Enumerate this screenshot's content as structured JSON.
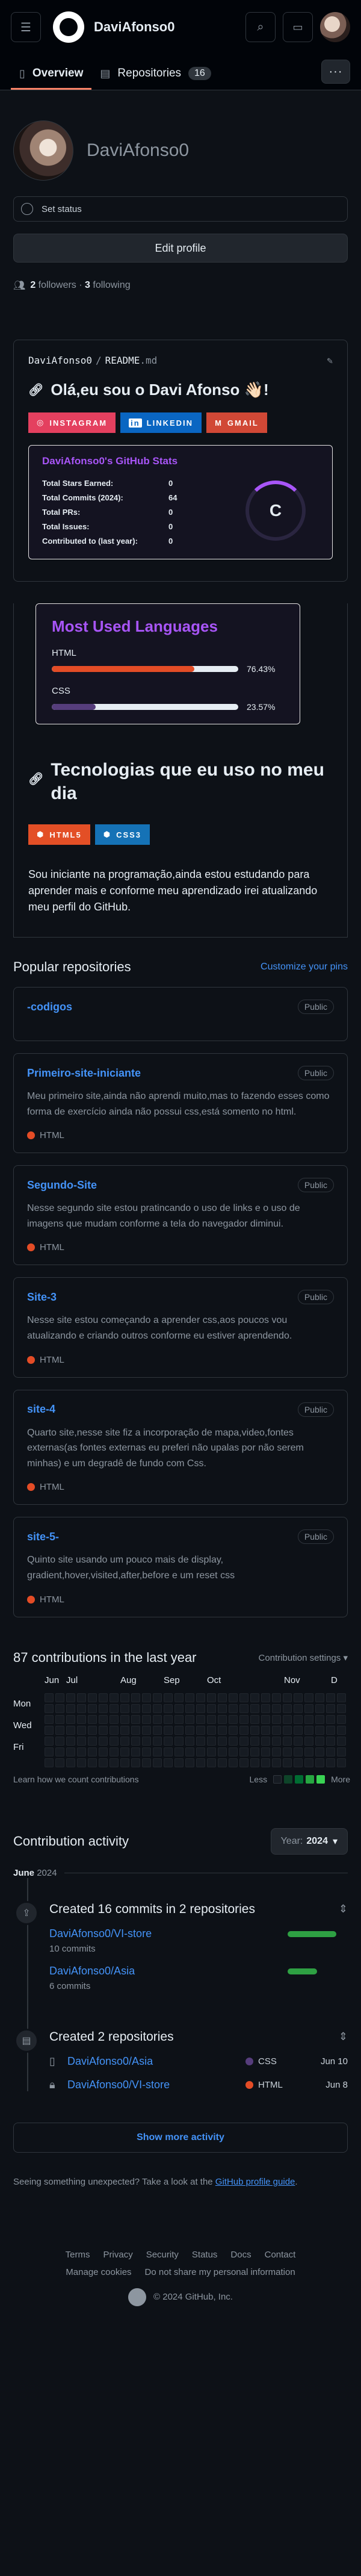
{
  "header": {
    "username": "DaviAfonso0"
  },
  "tabs": {
    "overview": "Overview",
    "repositories": "Repositories",
    "repo_count": "16"
  },
  "profile": {
    "display_name": "DaviAfonso0",
    "set_status": "Set status",
    "edit_profile": "Edit profile",
    "followers_count": "2",
    "followers_label": "followers",
    "following_count": "3",
    "following_label": "following"
  },
  "readme": {
    "owner": "DaviAfonso0",
    "separator": "/",
    "file": "README",
    "ext": ".md",
    "heading": "Olá,eu sou o Davi Afonso 👋🏻!",
    "badges": [
      "INSTAGRAM",
      "LINKEDIN",
      "GMAIL"
    ],
    "stats": {
      "title": "DaviAfonso0's GitHub Stats",
      "rows": [
        {
          "label": "Total Stars Earned:",
          "value": "0"
        },
        {
          "label": "Total Commits (2024):",
          "value": "64"
        },
        {
          "label": "Total PRs:",
          "value": "0"
        },
        {
          "label": "Total Issues:",
          "value": "0"
        },
        {
          "label": "Contributed to (last year):",
          "value": "0"
        }
      ],
      "rank": "C"
    },
    "languages": {
      "title": "Most Used Languages",
      "items": [
        {
          "name": "HTML",
          "percent": "76.43%",
          "value": 76.43,
          "color": "#e34c26"
        },
        {
          "name": "CSS",
          "percent": "23.57%",
          "value": 23.57,
          "color": "#563d7c"
        }
      ]
    },
    "tech_heading": "Tecnologias que eu uso no meu dia",
    "tech_badges": [
      "HTML5",
      "CSS3"
    ],
    "paragraph": "Sou iniciante na programação,ainda estou estudando para aprender mais e conforme meu aprendizado irei atualizando meu perfil do GitHub."
  },
  "popular": {
    "title": "Popular repositories",
    "customize": "Customize your pins",
    "public_label": "Public",
    "repos": [
      {
        "name": "-codigos",
        "desc": "",
        "lang": ""
      },
      {
        "name": "Primeiro-site-iniciante",
        "desc": "Meu primeiro site,ainda não aprendi muito,mas to fazendo esses como forma de exercício ainda não possui css,está somento no html.",
        "lang": "HTML"
      },
      {
        "name": "Segundo-Site",
        "desc": "Nesse segundo site estou pratincando o uso de links e o uso de imagens que mudam conforme a tela do navegador diminui.",
        "lang": "HTML"
      },
      {
        "name": "Site-3",
        "desc": "Nesse site estou começando a aprender css,aos poucos vou atualizando e criando outros conforme eu estiver aprendendo.",
        "lang": "HTML"
      },
      {
        "name": "site-4",
        "desc": "Quarto site,nesse site fiz a incorporação de mapa,video,fontes externas(as fontes externas eu preferi não upalas por não serem minhas) e um degradê de fundo com Css.",
        "lang": "HTML"
      },
      {
        "name": "site-5-",
        "desc": "Quinto site usando um pouco mais de display, gradient,hover,visited,after,before e um reset css",
        "lang": "HTML"
      }
    ]
  },
  "contributions": {
    "title": "87 contributions in the last year",
    "settings": "Contribution settings",
    "months": [
      "Jun",
      "Jul",
      "Aug",
      "Sep",
      "Oct",
      "Nov",
      "D"
    ],
    "days": [
      "Mon",
      "Wed",
      "Fri"
    ],
    "learn": "Learn how we count contributions",
    "less": "Less",
    "more": "More",
    "colors": [
      "#161b22",
      "#0e4429",
      "#006d32",
      "#26a641",
      "#39d353"
    ]
  },
  "activity": {
    "title": "Contribution activity",
    "year_label": "Year:",
    "year": "2024",
    "month": "June",
    "month_year": "2024",
    "commits": {
      "title": "Created 16 commits in 2 repositories",
      "rows": [
        {
          "repo": "DaviAfonso0/VI-store",
          "count": "10 commits",
          "ratio": 0.62
        },
        {
          "repo": "DaviAfonso0/Asia",
          "count": "6 commits",
          "ratio": 0.38
        }
      ]
    },
    "created": {
      "title": "Created 2 repositories",
      "rows": [
        {
          "repo": "DaviAfonso0/Asia",
          "lang": "CSS",
          "lang_color": "#563d7c",
          "date": "Jun 10"
        },
        {
          "repo": "DaviAfonso0/VI-store",
          "lang": "HTML",
          "lang_color": "#e34c26",
          "date": "Jun 8"
        }
      ]
    },
    "show_more": "Show more activity",
    "unexpected": "Seeing something unexpected? Take a look at the ",
    "guide_link": "GitHub profile guide",
    "guide_end": "."
  },
  "footer": {
    "links": [
      "Terms",
      "Privacy",
      "Security",
      "Status",
      "Docs",
      "Contact"
    ],
    "links2": [
      "Manage cookies",
      "Do not share my personal information"
    ],
    "copyright": "© 2024 GitHub, Inc."
  }
}
